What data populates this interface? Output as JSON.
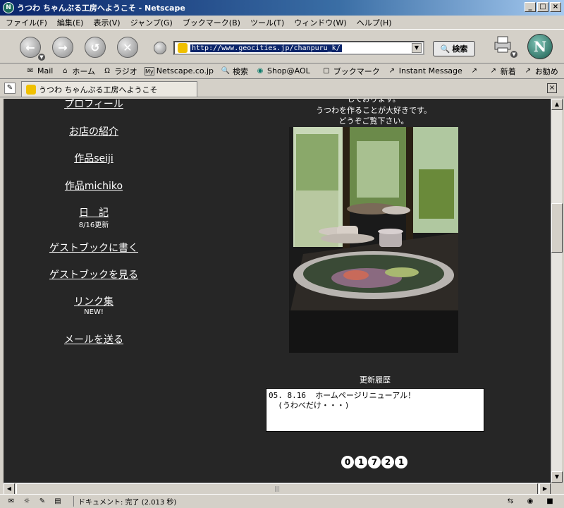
{
  "window": {
    "title": "うつわ ちゃんぷる工房へようこそ - Netscape"
  },
  "menu": [
    "ファイル(F)",
    "編集(E)",
    "表示(V)",
    "ジャンプ(G)",
    "ブックマーク(B)",
    "ツール(T)",
    "ウィンドウ(W)",
    "ヘルプ(H)"
  ],
  "navbar": {
    "url": "http://www.geocities.jp/chanpuru_k/",
    "search_label": "検索"
  },
  "personal_toolbar": [
    "Mail",
    "ホーム",
    "ラジオ",
    "Netscape.co.jp",
    "検索",
    "Shop@AOL",
    "ブックマーク",
    "Instant Message",
    "新着",
    "お勧め"
  ],
  "tab": {
    "title": "うつわ ちゃんぷる工房へようこそ"
  },
  "page": {
    "nav": [
      {
        "label": "プロフィール"
      },
      {
        "label": "お店の紹介"
      },
      {
        "label": "作品seiji"
      },
      {
        "label": "作品michiko"
      },
      {
        "label": "日　記",
        "note": "8/16更新"
      },
      {
        "label": "ゲストブックに書く"
      },
      {
        "label": "ゲストブックを見る"
      },
      {
        "label": "リンク集",
        "note": "NEW!"
      },
      {
        "label": "メールを送る"
      }
    ],
    "intro": [
      "しております。",
      "うつわを作ることが大好きです。",
      "どうぞご覧下さい。"
    ],
    "history_title": "更新履歴",
    "history_text": "05. 8.16  ホームページリニューアル！\n  (うわべだけ・・・)",
    "counter": [
      "0",
      "1",
      "7",
      "2",
      "1"
    ]
  },
  "status": {
    "text": "ドキュメント: 完了 (2.013 秒)"
  }
}
